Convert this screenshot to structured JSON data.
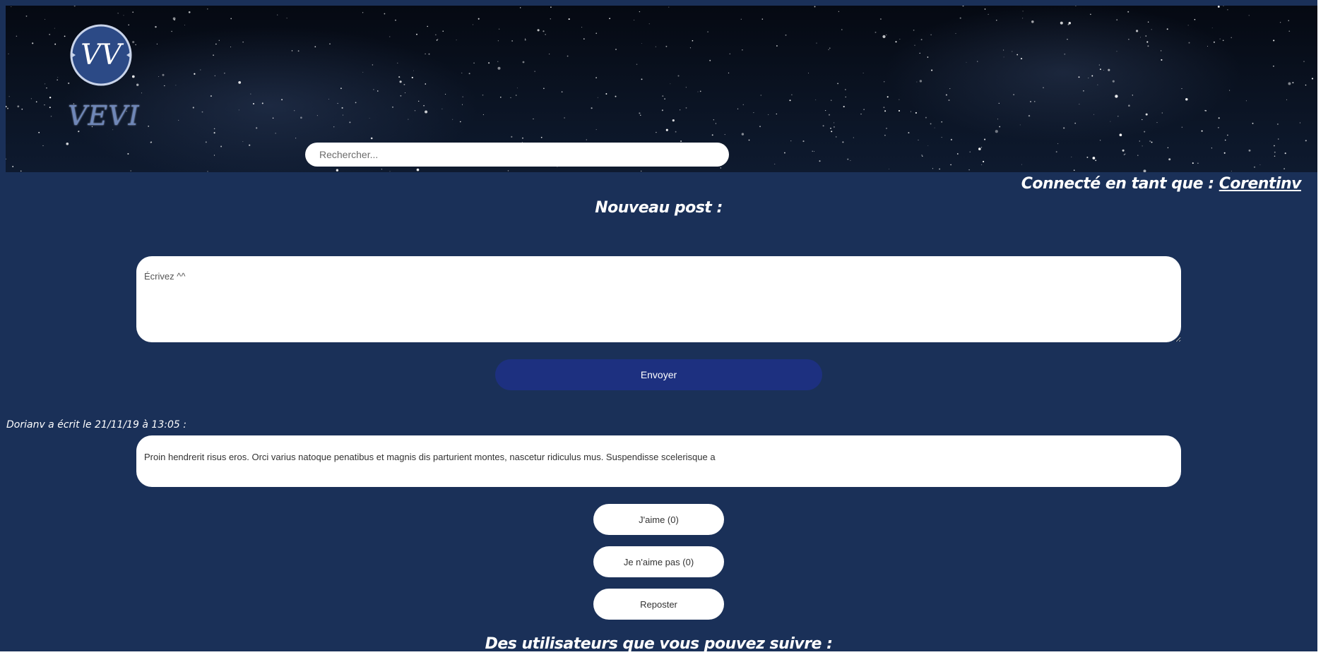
{
  "colors": {
    "page_background": "#1a3058",
    "send_button": "#1d3080",
    "field_background": "#ffffff"
  },
  "header": {
    "logo_text": "VEVI",
    "logo_mark_text": "VV"
  },
  "search": {
    "placeholder": "Rechercher..."
  },
  "session": {
    "prefix": "Connecté en tant que :",
    "username": "Corentinv"
  },
  "new_post": {
    "title": "Nouveau post :",
    "placeholder": "Écrivez ^^",
    "send_label": "Envoyer"
  },
  "feed": {
    "posts": [
      {
        "meta": "Dorianv a écrit le 21/11/19 à 13:05 :",
        "content": "Proin hendrerit risus eros. Orci varius natoque penatibus et magnis dis parturient montes, nascetur ridiculus mus. Suspendisse scelerisque a",
        "like_label": "J'aime (0)",
        "dislike_label": "Je n'aime pas (0)",
        "repost_label": "Reposter"
      }
    ]
  },
  "suggestions": {
    "title": "Des utilisateurs que vous pouvez suivre :"
  }
}
